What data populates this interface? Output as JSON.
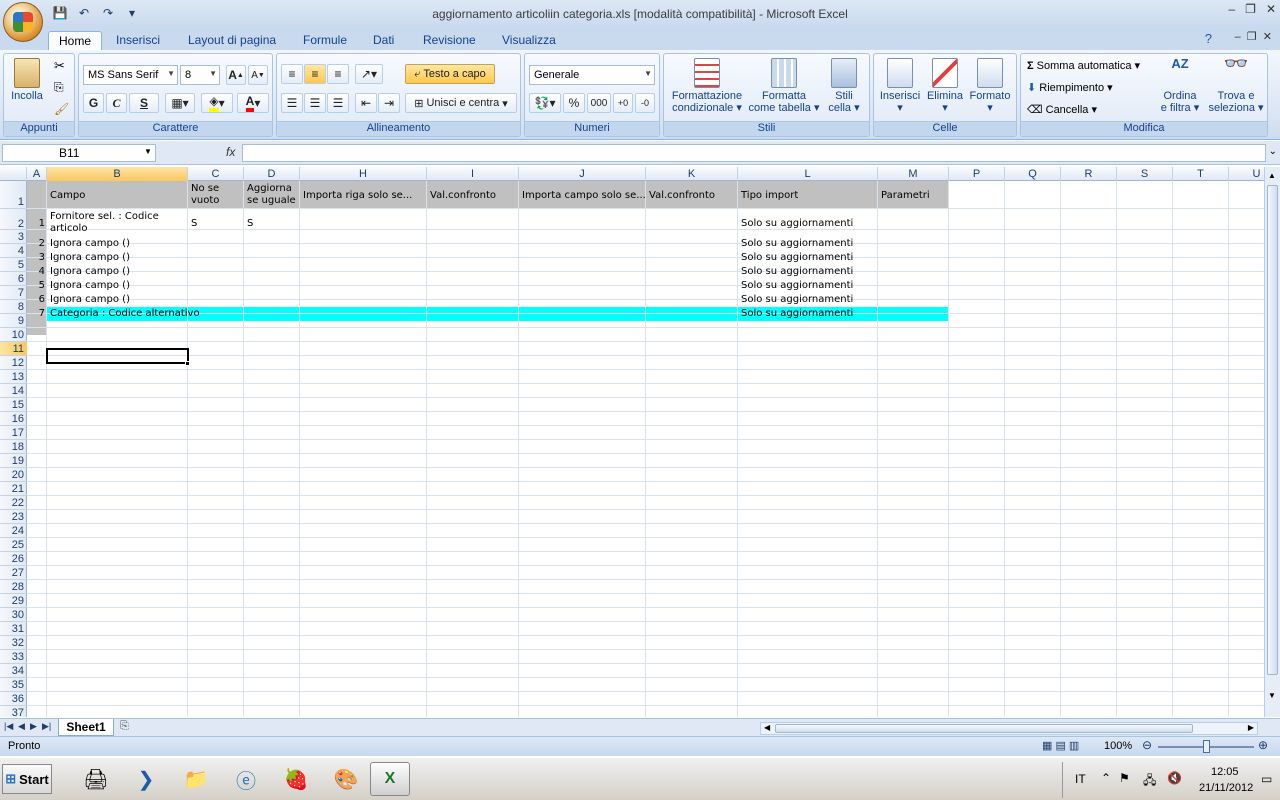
{
  "window": {
    "title": "aggiornamento articoliin categoria.xls  [modalità compatibilità] - Microsoft Excel",
    "controls": [
      "_",
      "□",
      "X"
    ]
  },
  "ribbon_tabs": [
    "Home",
    "Inserisci",
    "Layout di pagina",
    "Formule",
    "Dati",
    "Revisione",
    "Visualizza"
  ],
  "ribbon": {
    "clipboard": {
      "paste": "Incolla",
      "label": "Appunti"
    },
    "font": {
      "name": "MS Sans Serif",
      "size": "8",
      "bold": "G",
      "italic": "C",
      "underline": "S",
      "label": "Carattere"
    },
    "alignment": {
      "wrap": "Testo a capo",
      "merge": "Unisci e centra",
      "label": "Allineamento"
    },
    "number": {
      "format": "Generale",
      "percent": "%",
      "thousands": "000",
      "label": "Numeri"
    },
    "styles": {
      "cond_line1": "Formattazione",
      "cond_line2": "condizionale",
      "table_line1": "Formatta",
      "table_line2": "come tabella",
      "cell_line1": "Stili",
      "cell_line2": "cella",
      "label": "Stili"
    },
    "cells": {
      "insert": "Inserisci",
      "delete": "Elimina",
      "format": "Formato",
      "label": "Celle"
    },
    "editing": {
      "autosum": "Somma automatica",
      "fill": "Riempimento",
      "clear": "Cancella",
      "sort_line1": "Ordina",
      "sort_line2": "e filtra",
      "find_line1": "Trova e",
      "find_line2": "seleziona",
      "label": "Modifica"
    }
  },
  "formula_bar": {
    "name_box": "B11",
    "fx": "fx",
    "value": ""
  },
  "columns": [
    "A",
    "B",
    "C",
    "D",
    "H",
    "I",
    "J",
    "K",
    "L",
    "M",
    "P",
    "Q",
    "R",
    "S",
    "T",
    "U"
  ],
  "rows": [
    "1",
    "2",
    "3",
    "4",
    "5",
    "6",
    "7",
    "8",
    "9",
    "10",
    "11",
    "12",
    "13",
    "14",
    "15",
    "16",
    "17",
    "18",
    "19",
    "20",
    "21",
    "22",
    "23",
    "24",
    "25",
    "26",
    "27",
    "28",
    "29",
    "30",
    "31",
    "32",
    "33",
    "34",
    "35",
    "36",
    "37"
  ],
  "sheet": {
    "headers": {
      "B": "Campo",
      "C1": "No se",
      "C2": "vuoto",
      "D1": "Aggiorna",
      "D2": "se uguale",
      "H": "Importa riga solo se...",
      "I": "Val.confronto",
      "J": "Importa campo solo se...",
      "K": "Val.confronto",
      "L": "Tipo import",
      "M": "Parametri"
    },
    "data": [
      {
        "A": "1",
        "B1": "Fornitore sel. : Codice",
        "B2": "articolo",
        "C": "S",
        "D": "S",
        "L": "Solo su aggiornamenti"
      },
      {
        "A": "2",
        "B": "Ignora campo ()",
        "L": "Solo su aggiornamenti"
      },
      {
        "A": "3",
        "B": "Ignora campo ()",
        "L": "Solo su aggiornamenti"
      },
      {
        "A": "4",
        "B": "Ignora campo ()",
        "L": "Solo su aggiornamenti"
      },
      {
        "A": "5",
        "B": "Ignora campo ()",
        "L": "Solo su aggiornamenti"
      },
      {
        "A": "6",
        "B": "Ignora campo ()",
        "L": "Solo su aggiornamenti"
      },
      {
        "A": "7",
        "B": "Categoria : Codice alternativo",
        "L": "Solo su aggiornamenti"
      }
    ],
    "highlight_color": "#00ffff",
    "header_fill": "#c0c0c0"
  },
  "sheet_tabs": [
    "Sheet1"
  ],
  "status": {
    "text": "Pronto",
    "zoom": "100%"
  },
  "taskbar": {
    "start": "Start",
    "lang": "IT",
    "time": "12:05",
    "date": "21/11/2012"
  }
}
